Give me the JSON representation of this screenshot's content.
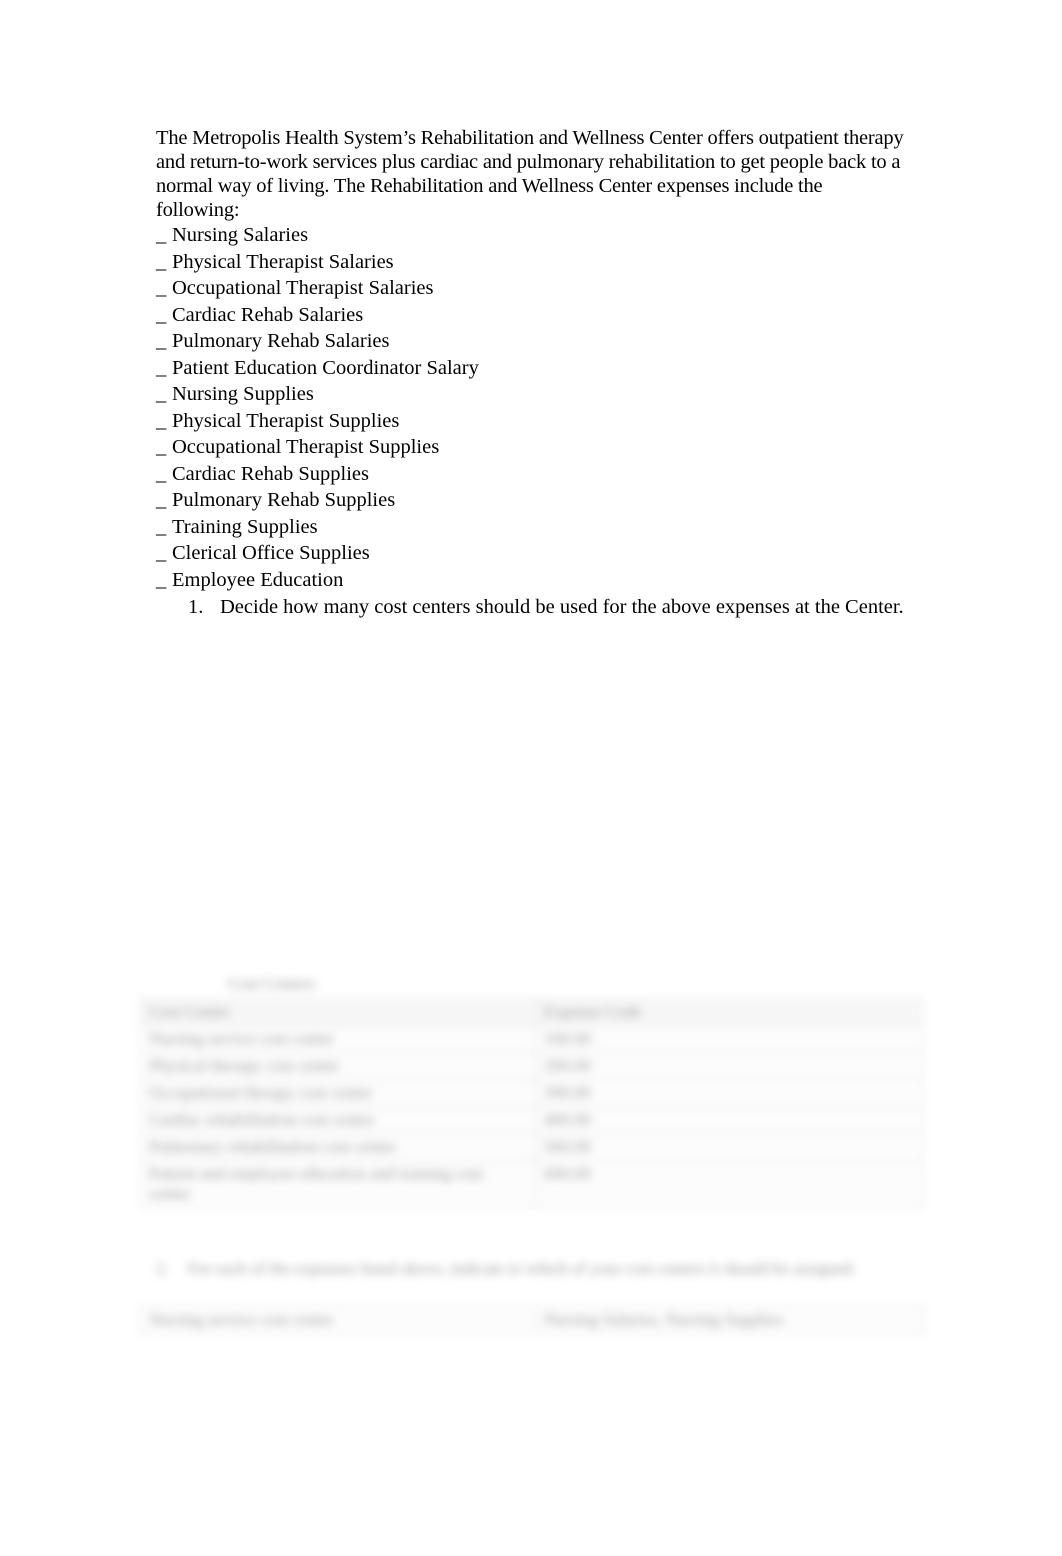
{
  "document": {
    "intro_paragraph": "The Metropolis Health System’s Rehabilitation and Wellness Center offers outpatient therapy and return-to-work services plus cardiac and pulmonary rehabilitation to get people back to a normal way of living. The Rehabilitation and Wellness Center expenses include the following:",
    "bullet_marker": "_",
    "expenses": [
      "Nursing Salaries",
      "Physical Therapist Salaries",
      "Occupational Therapist Salaries",
      "Cardiac Rehab Salaries",
      "Pulmonary Rehab Salaries",
      "Patient Education Coordinator Salary",
      "Nursing Supplies",
      "Physical Therapist Supplies",
      "Occupational Therapist Supplies",
      "Cardiac Rehab Supplies",
      "Pulmonary Rehab Supplies",
      "Training Supplies",
      "Clerical Office Supplies",
      "Employee Education"
    ],
    "questions": [
      {
        "number": "1.",
        "text": "Decide how many cost centers should be used for the above expenses at the Center."
      }
    ]
  },
  "redacted_section": {
    "caption": "Cost Centers",
    "cost_center_table": {
      "headers": [
        "Cost Center",
        "Expense Code"
      ],
      "rows": [
        [
          "Nursing service cost center",
          "100.00"
        ],
        [
          "Physical therapy cost center",
          "200.00"
        ],
        [
          "Occupational therapy cost center",
          "300.00"
        ],
        [
          "Cardiac rehabilitation cost center",
          "400.00"
        ],
        [
          "Pulmonary rehabilitation cost center",
          "500.00"
        ],
        [
          "Patient and employee education and training cost center",
          "600.00"
        ]
      ]
    },
    "question": {
      "number": "2.",
      "text": "For each of the expenses listed above, indicate to which of your cost centers it should be assigned."
    },
    "assignment_table": {
      "rows": [
        [
          "Nursing service cost center",
          "Nursing Salaries, Nursing Supplies"
        ]
      ]
    }
  }
}
